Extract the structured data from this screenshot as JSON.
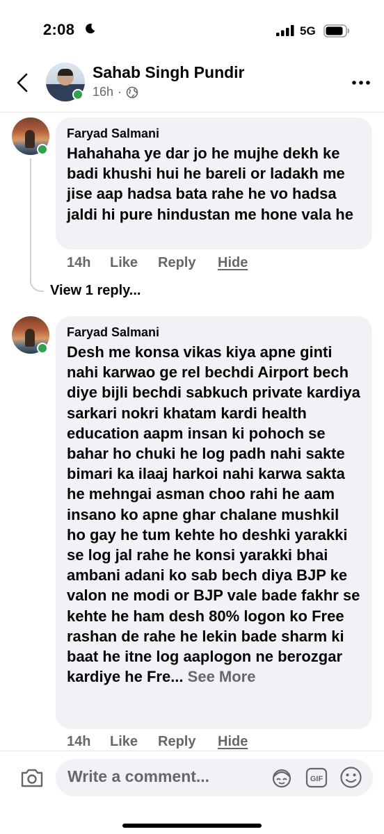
{
  "status_bar": {
    "time": "2:08",
    "network": "5G",
    "icons": [
      "moon-icon",
      "signal-icon",
      "battery-icon"
    ]
  },
  "header": {
    "name": "Sahab Singh Pundir",
    "time": "16h",
    "separator": "·",
    "privacy_icon": "globe-icon",
    "icons": [
      "back-icon",
      "more-icon"
    ]
  },
  "comments": [
    {
      "author": "Faryad Salmani",
      "text": "Hahahaha ye dar jo he mujhe dekh ke badi khushi hui he bareli or ladakh me jise aap hadsa bata rahe he vo hadsa jaldi hi pure hindustan me hone vala he",
      "time": "14h",
      "like": "Like",
      "reply": "Reply",
      "hide": "Hide",
      "view_replies": "View 1 reply..."
    },
    {
      "author": "Faryad Salmani",
      "text": "Desh me konsa vikas kiya apne ginti nahi karwao ge rel bechdi Airport bech diye bijli bechdi sabkuch private kardiya sarkari nokri khatam kardi health education aapm insan ki pohoch se bahar ho chuki he log padh nahi sakte bimari ka ilaaj harkoi nahi karwa sakta he mehngai asman choo rahi he aam insano ko apne ghar chalane mushkil ho gay he tum kehte ho deshki yarakki se log jal rahe he konsi yarakki bhai ambani adani ko sab bech diya BJP ke valon ne modi or BJP vale bade fakhr se kehte he ham desh 80% logon ko Free rashan de rahe he lekin bade sharm ki baat he itne log aaplogon ne berozgar kardiye he Fre...",
      "see_more": "See More",
      "time": "14h",
      "like": "Like",
      "reply": "Reply",
      "hide": "Hide"
    }
  ],
  "composer": {
    "placeholder": "Write a comment...",
    "icons": [
      "camera-icon",
      "avatar-sticker-icon",
      "gif-icon",
      "emoji-icon"
    ]
  },
  "colors": {
    "text": "#050505",
    "secondary": "#65676b",
    "bubble": "#f0f2f5",
    "online": "#31a24c"
  }
}
